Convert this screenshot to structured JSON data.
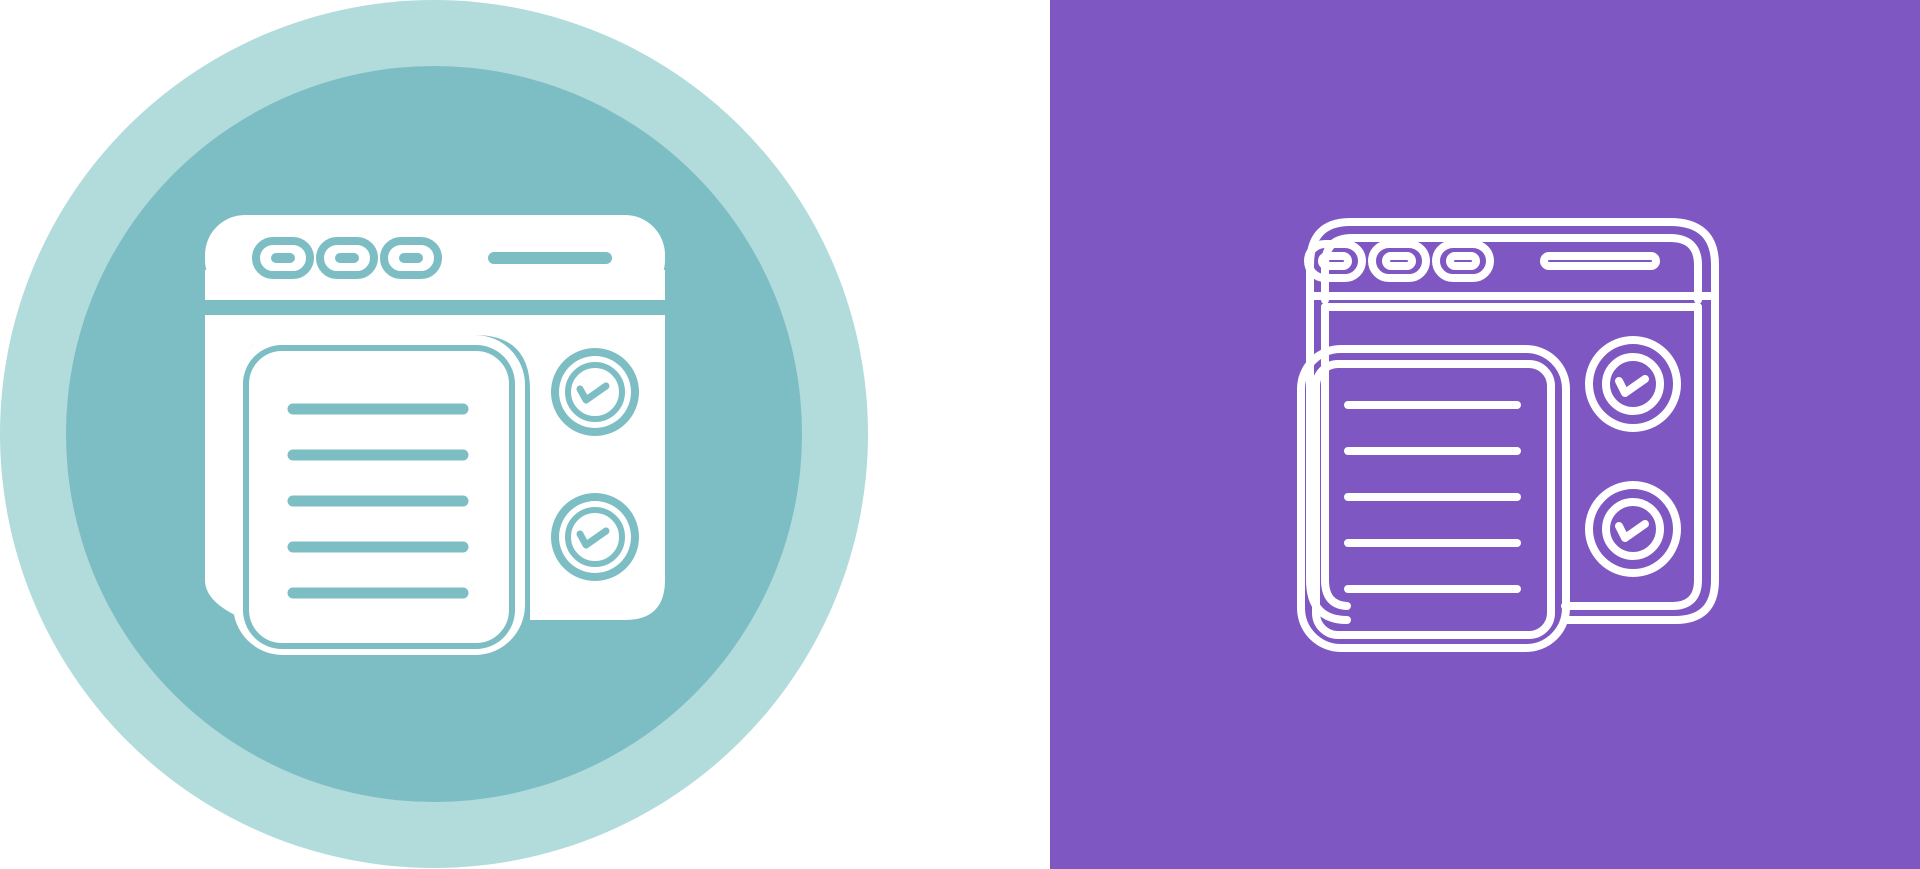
{
  "panels": [
    {
      "name": "glyph-style-icon",
      "style": "filled glyph",
      "icon": "browser-checklist-icon"
    },
    {
      "name": "line-style-icon",
      "style": "outline line",
      "icon": "browser-checklist-icon"
    }
  ],
  "colors": {
    "page_background": "#ffffff",
    "outer_ring": "#b2dbdc",
    "inner_circle": "#7dbdc4",
    "glyph_fill": "#ffffff",
    "glyph_accent": "#7dbdc4",
    "purple_background": "#7e57c2",
    "outline_stroke": "#ffffff"
  }
}
